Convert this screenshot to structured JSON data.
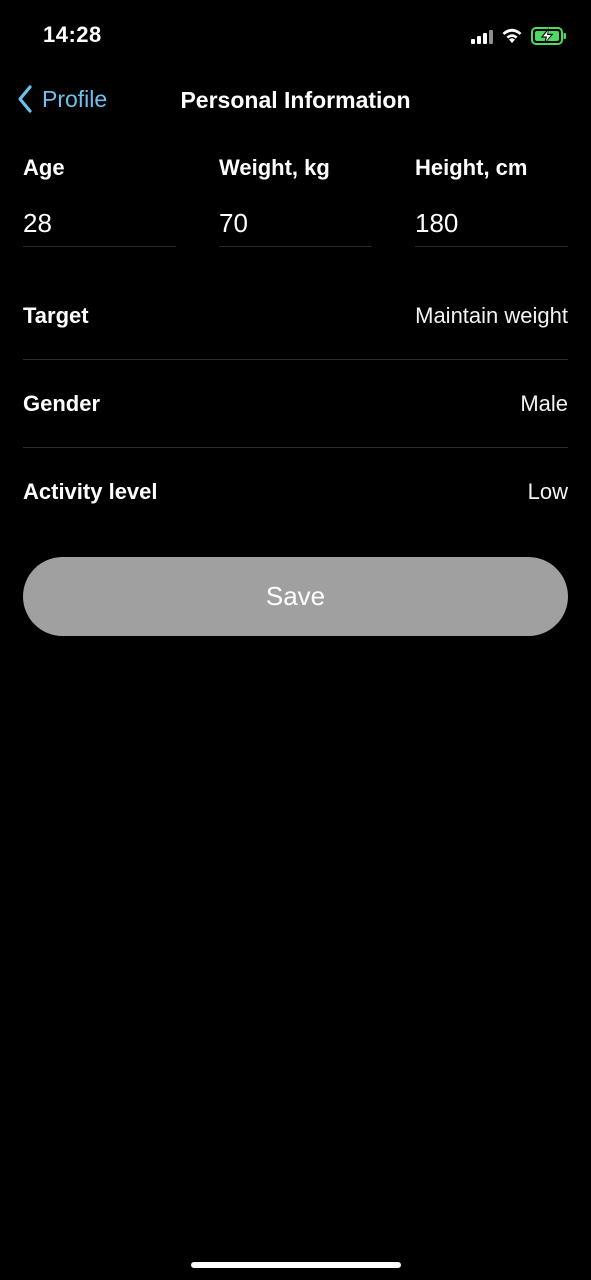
{
  "status_bar": {
    "time": "14:28",
    "icons": [
      "signal-icon",
      "wifi-icon",
      "battery-charging-icon"
    ],
    "battery_color": "#4cd964"
  },
  "nav": {
    "back_label": "Profile",
    "back_icon": "chevron-left-icon",
    "title": "Personal Information",
    "accent_color": "#6ec1ee"
  },
  "measurements": {
    "age": {
      "label": "Age",
      "value": "28"
    },
    "weight": {
      "label": "Weight, kg",
      "value": "70"
    },
    "height": {
      "label": "Height, cm",
      "value": "180"
    }
  },
  "settings": {
    "target": {
      "label": "Target",
      "value": "Maintain weight"
    },
    "gender": {
      "label": "Gender",
      "value": "Male"
    },
    "activity": {
      "label": "Activity level",
      "value": "Low"
    }
  },
  "actions": {
    "save_label": "Save",
    "save_color": "#a0a0a0"
  }
}
